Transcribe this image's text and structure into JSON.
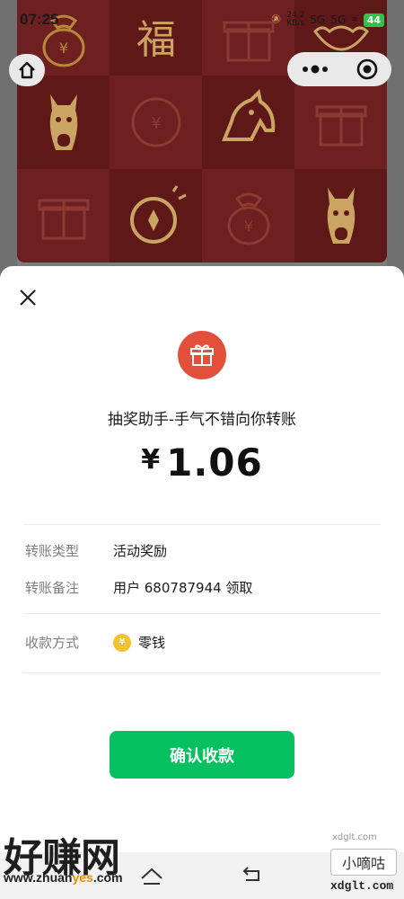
{
  "status_bar": {
    "time": "07:25",
    "net_speed": "24.2",
    "net_unit": "KB/s",
    "signal_1": "5G",
    "signal_2": "5G",
    "battery": "44"
  },
  "background_tiles": [
    "coin-bag-icon",
    "fu-character",
    "gift-box-icon",
    "gold-ingot-icon",
    "horse-head-icon",
    "coin-icon",
    "horse-head-icon",
    "gift-box-icon",
    "gift-box-icon",
    "coin-icon",
    "coin-bag-icon",
    "horse-head-icon"
  ],
  "fu_text": "福",
  "transfer": {
    "sender_line": "抽奖助手-手气不错向你转账",
    "currency": "¥",
    "amount": "1.06",
    "rows": [
      {
        "label": "转账类型",
        "value": "活动奖励"
      },
      {
        "label": "转账备注",
        "value": "用户 680787944 领取"
      },
      {
        "label": "收款方式",
        "value": "零钱"
      }
    ],
    "confirm_label": "确认收款"
  },
  "watermark": {
    "logo": "好赚网",
    "url_a": "www.zhuan",
    "url_b": "yes",
    "url_c": ".com",
    "small_text": "xdglt.com",
    "box_text": "小嘀咕",
    "url2": "xdglt.com"
  },
  "colors": {
    "accent_green": "#07c160",
    "gift_red": "#e2503c",
    "coin_yellow": "#f2c230",
    "tile_red": "#6e1f1f"
  }
}
